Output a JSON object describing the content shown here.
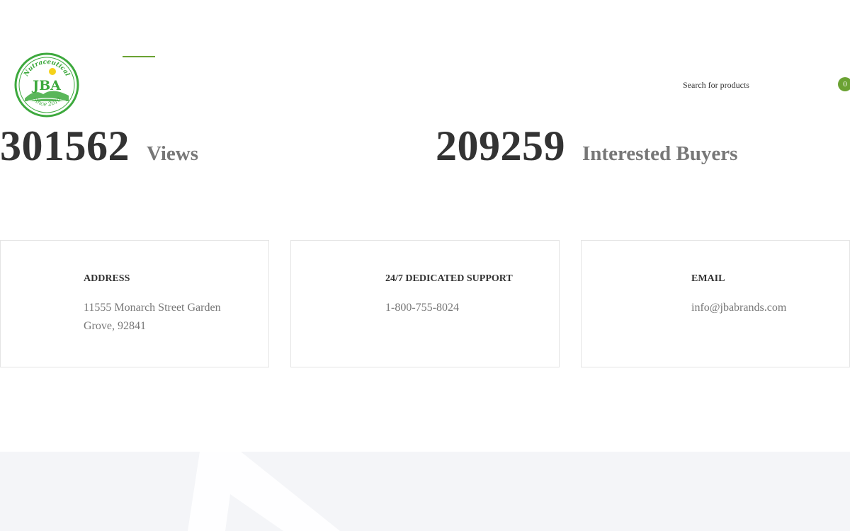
{
  "header": {
    "logo": {
      "brand": "JBA",
      "top_arc": "Nutraceutical",
      "bottom_arc": "Since 2010",
      "colors": {
        "green": "#3da93d",
        "sun": "#f5d21a"
      }
    },
    "search": {
      "placeholder": "Search for products"
    },
    "cart": {
      "count": "0",
      "color": "#6ba233"
    },
    "accent_color": "#6ba233"
  },
  "stats": [
    {
      "value": "301562",
      "label": "Views"
    },
    {
      "value": "209259",
      "label": "Interested Buyers"
    }
  ],
  "contact_cards": [
    {
      "title": "ADDRESS",
      "text": "11555 Monarch Street Garden Grove,  92841"
    },
    {
      "title": "24/7 DEDICATED SUPPORT",
      "text": "1-800-755-8024"
    },
    {
      "title": "EMAIL",
      "text": "info@jbabrands.com"
    }
  ]
}
